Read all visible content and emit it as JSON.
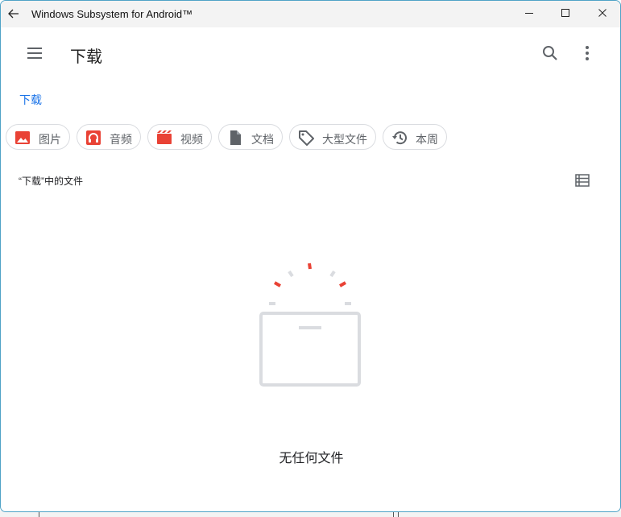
{
  "window": {
    "title": "Windows Subsystem for Android™",
    "back_icon": "arrow-left-icon",
    "controls": [
      "minimize-icon",
      "maximize-icon",
      "close-icon"
    ]
  },
  "appbar": {
    "title": "下载",
    "menu_icon": "hamburger-menu-icon",
    "search_icon": "search-icon",
    "more_icon": "more-vertical-icon"
  },
  "breadcrumb": {
    "label": "下载"
  },
  "chips": [
    {
      "label": "图片",
      "icon": "image-icon",
      "color": "#e94235"
    },
    {
      "label": "音频",
      "icon": "headphones-icon",
      "color": "#e94235"
    },
    {
      "label": "视频",
      "icon": "video-clapper-icon",
      "color": "#e94235"
    },
    {
      "label": "文档",
      "icon": "document-icon",
      "color": "#5f6368"
    },
    {
      "label": "大型文件",
      "icon": "tag-icon",
      "color": "#5f6368"
    },
    {
      "label": "本周",
      "icon": "history-icon",
      "color": "#5f6368"
    }
  ],
  "section": {
    "title": "“下载”中的文件",
    "view_icon": "list-view-icon"
  },
  "empty_state": {
    "message": "无任何文件",
    "illustration": "empty-folder-icon",
    "accent": "#e94235",
    "muted": "#dadce0"
  },
  "colors": {
    "link": "#1a73e8",
    "chip_border": "#dadce0",
    "window_border": "#4fa3c7"
  }
}
